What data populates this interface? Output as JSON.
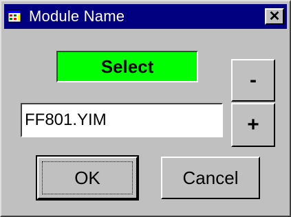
{
  "window": {
    "title": "Module Name",
    "close_label": "✕",
    "icon": "module-app-icon"
  },
  "status": {
    "label": "Select",
    "color": "#00ff00"
  },
  "spinner": {
    "minus_label": "-",
    "plus_label": "+"
  },
  "module": {
    "value": "FF801.YIM"
  },
  "buttons": {
    "ok_label": "OK",
    "cancel_label": "Cancel"
  }
}
